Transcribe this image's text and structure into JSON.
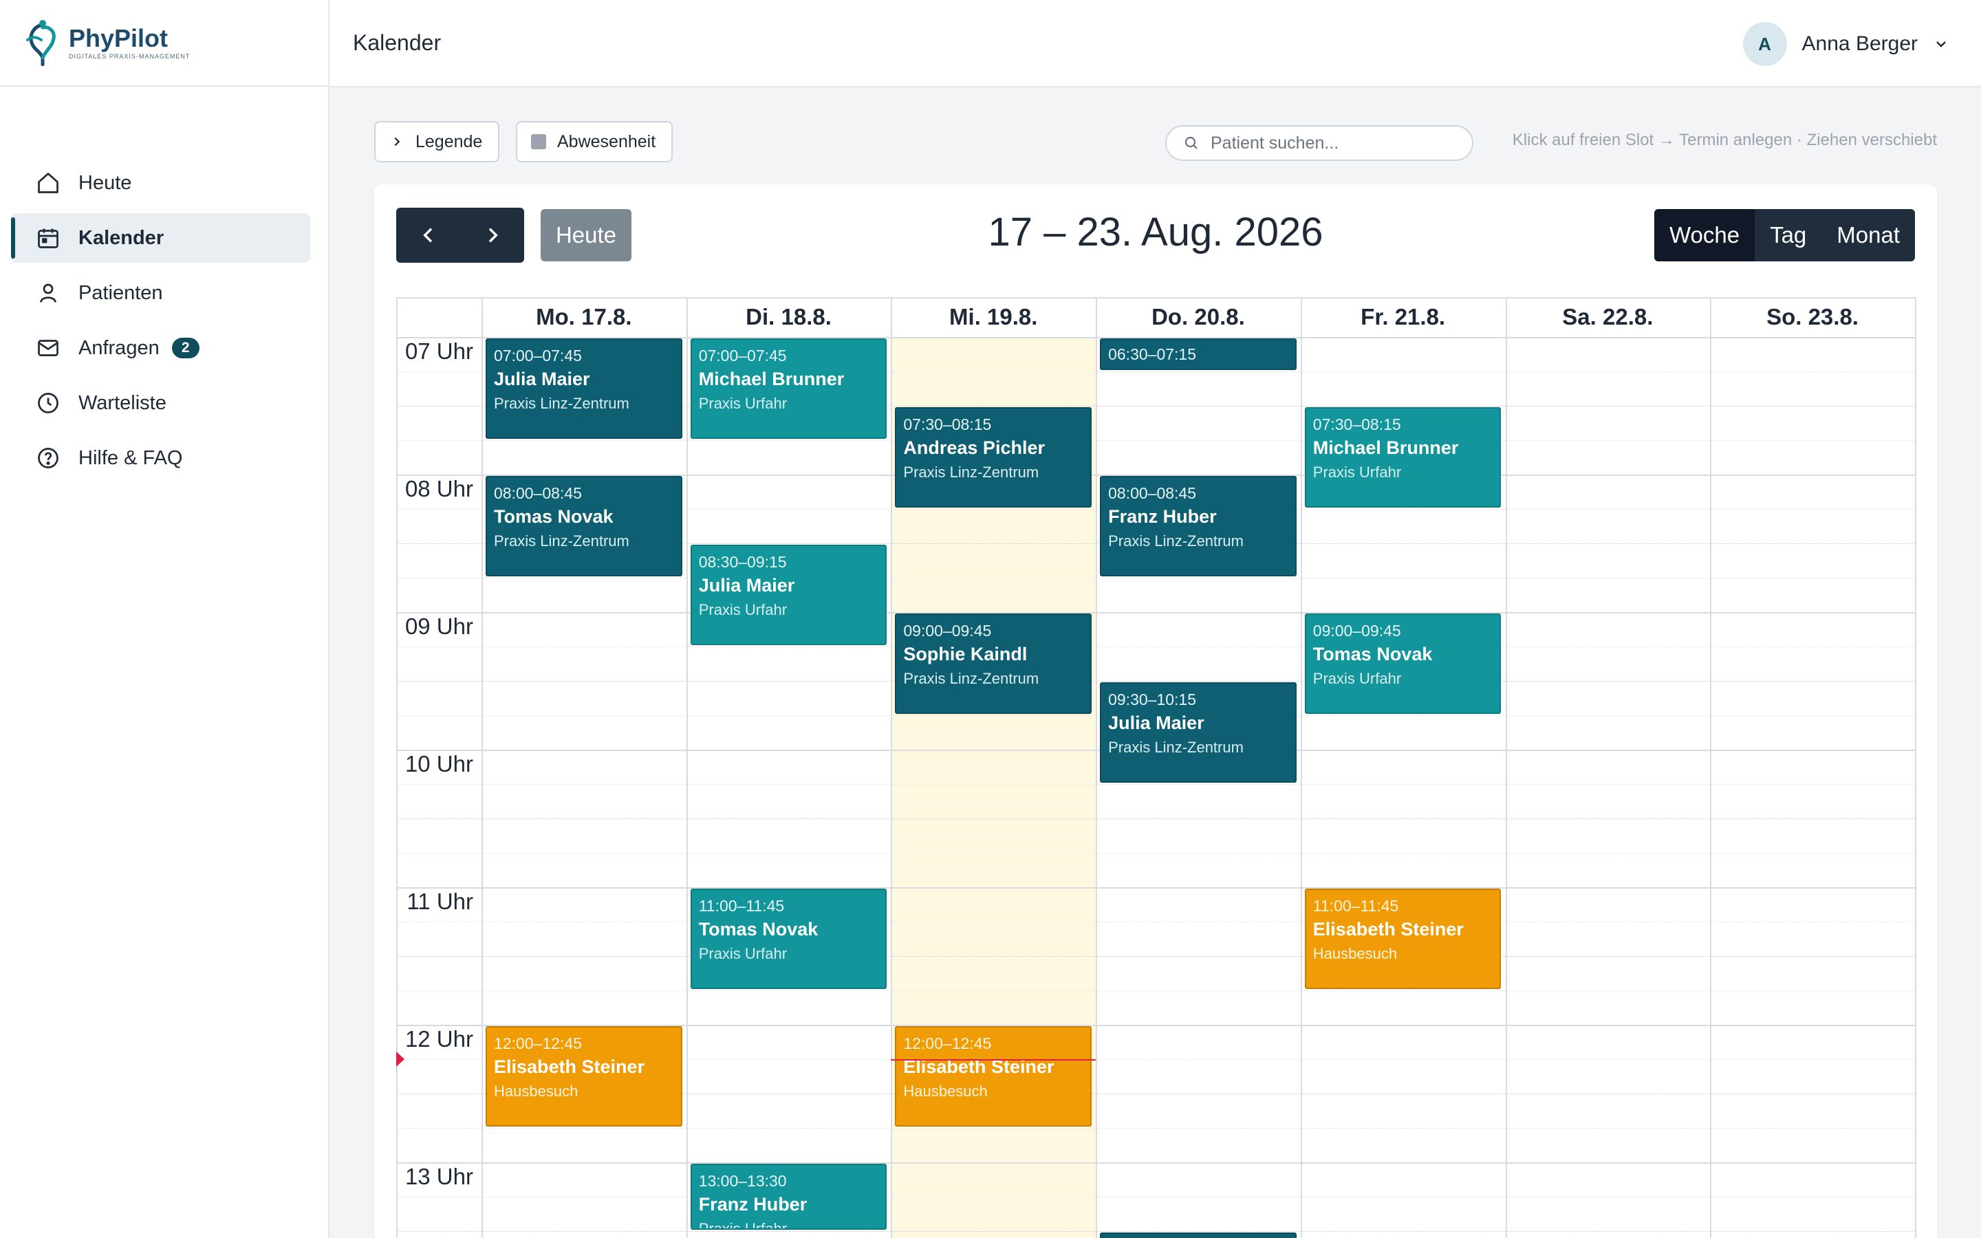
{
  "app": {
    "name": "PhyPilot",
    "tagline": "DIGITALES PRAXIS-MANAGEMENT"
  },
  "sidebar": {
    "items": [
      {
        "label": "Heute",
        "icon": "home-icon"
      },
      {
        "label": "Kalender",
        "icon": "calendar-icon",
        "active": true
      },
      {
        "label": "Patienten",
        "icon": "user-icon"
      },
      {
        "label": "Anfragen",
        "icon": "mail-icon",
        "badge": "2"
      },
      {
        "label": "Warteliste",
        "icon": "clock-icon"
      },
      {
        "label": "Hilfe & FAQ",
        "icon": "help-icon"
      }
    ]
  },
  "header": {
    "title": "Kalender",
    "user": {
      "initial": "A",
      "name": "Anna Berger"
    }
  },
  "toolbar": {
    "legend_label": "Legende",
    "absence_label": "Abwesenheit",
    "search_placeholder": "Patient suchen...",
    "hint": "Klick auf freien Slot → Termin anlegen · Ziehen verschiebt"
  },
  "calendar": {
    "today_label": "Heute",
    "range": "17 – 23. Aug. 2026",
    "views": [
      "Woche",
      "Tag",
      "Monat"
    ],
    "active_view": "Woche",
    "days": [
      "Mo. 17.8.",
      "Di. 18.8.",
      "Mi. 19.8.",
      "Do. 20.8.",
      "Fr. 21.8.",
      "Sa. 22.8.",
      "So. 23.8."
    ],
    "today_index": 2,
    "hours": [
      "07 Uhr",
      "08 Uhr",
      "09 Uhr",
      "10 Uhr",
      "11 Uhr",
      "12 Uhr",
      "13 Uhr"
    ],
    "now_time": "12:15",
    "colors": {
      "dark": "#0f5f72",
      "teal": "#13969b",
      "orange": "#f09c06",
      "today": "#fff8e1",
      "now": "#e11d48"
    },
    "events": [
      {
        "day": 0,
        "start": "07:00",
        "end": "07:45",
        "time": "07:00–07:45",
        "name": "Julia Maier",
        "location": "Praxis Linz-Zentrum",
        "color": "dark"
      },
      {
        "day": 0,
        "start": "08:00",
        "end": "08:45",
        "time": "08:00–08:45",
        "name": "Tomas Novak",
        "location": "Praxis Linz-Zentrum",
        "color": "dark"
      },
      {
        "day": 0,
        "start": "12:00",
        "end": "12:45",
        "time": "12:00–12:45",
        "name": "Elisabeth Steiner",
        "location": "Hausbesuch",
        "color": "orange"
      },
      {
        "day": 1,
        "start": "07:00",
        "end": "07:45",
        "time": "07:00–07:45",
        "name": "Michael Brunner",
        "location": "Praxis Urfahr",
        "color": "teal"
      },
      {
        "day": 1,
        "start": "08:30",
        "end": "09:15",
        "time": "08:30–09:15",
        "name": "Julia Maier",
        "location": "Praxis Urfahr",
        "color": "teal"
      },
      {
        "day": 1,
        "start": "11:00",
        "end": "11:45",
        "time": "11:00–11:45",
        "name": "Tomas Novak",
        "location": "Praxis Urfahr",
        "color": "teal"
      },
      {
        "day": 1,
        "start": "13:00",
        "end": "13:30",
        "time": "13:00–13:30",
        "name": "Franz Huber",
        "location": "Praxis Urfahr",
        "color": "teal"
      },
      {
        "day": 2,
        "start": "07:30",
        "end": "08:15",
        "time": "07:30–08:15",
        "name": "Andreas Pichler",
        "location": "Praxis Linz-Zentrum",
        "color": "dark"
      },
      {
        "day": 2,
        "start": "09:00",
        "end": "09:45",
        "time": "09:00–09:45",
        "name": "Sophie Kaindl",
        "location": "Praxis Linz-Zentrum",
        "color": "dark"
      },
      {
        "day": 2,
        "start": "12:00",
        "end": "12:45",
        "time": "12:00–12:45",
        "name": "Elisabeth Steiner",
        "location": "Hausbesuch",
        "color": "orange"
      },
      {
        "day": 3,
        "start": "06:30",
        "end": "07:15",
        "time": "06:30–07:15",
        "name": "",
        "location": "",
        "color": "dark"
      },
      {
        "day": 3,
        "start": "08:00",
        "end": "08:45",
        "time": "08:00–08:45",
        "name": "Franz Huber",
        "location": "Praxis Linz-Zentrum",
        "color": "dark"
      },
      {
        "day": 3,
        "start": "09:30",
        "end": "10:15",
        "time": "09:30–10:15",
        "name": "Julia Maier",
        "location": "Praxis Linz-Zentrum",
        "color": "dark"
      },
      {
        "day": 3,
        "start": "13:30",
        "end": "14:15",
        "time": "",
        "name": "",
        "location": "",
        "color": "dark"
      },
      {
        "day": 4,
        "start": "07:30",
        "end": "08:15",
        "time": "07:30–08:15",
        "name": "Michael Brunner",
        "location": "Praxis Urfahr",
        "color": "teal"
      },
      {
        "day": 4,
        "start": "09:00",
        "end": "09:45",
        "time": "09:00–09:45",
        "name": "Tomas Novak",
        "location": "Praxis Urfahr",
        "color": "teal"
      },
      {
        "day": 4,
        "start": "11:00",
        "end": "11:45",
        "time": "11:00–11:45",
        "name": "Elisabeth Steiner",
        "location": "Hausbesuch",
        "color": "orange"
      }
    ]
  }
}
